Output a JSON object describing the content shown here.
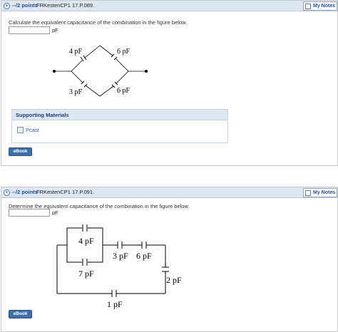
{
  "q1": {
    "points": "--/2 points",
    "id": "FRKestenCP1 17.P.089.",
    "notes": "My Notes",
    "prompt": "Calculate the equivalent capacitance of the combination in the figure below.",
    "unit": "pF",
    "answer": "",
    "caps": [
      "4 pF",
      "6 pF",
      "3 pF",
      "6 pF"
    ],
    "support_title": "Supporting Materials",
    "pcast": "Pcast",
    "ebook": "eBook"
  },
  "q2": {
    "points": "--/2 points",
    "id": "FRKestenCP1 17.P.091.",
    "notes": "My Notes",
    "prompt": "Determine the equivalent capacitance of the combination in the figure below.",
    "unit": "pF",
    "answer": "",
    "caps": [
      "4 pF",
      "7 pF",
      "3 pF",
      "6 pF",
      "2 pF",
      "1 pF"
    ],
    "ebook": "eBook"
  },
  "colors": {
    "header": "#dde6f3",
    "link": "#1f5fc4",
    "ebook": "#3d6fa8"
  }
}
